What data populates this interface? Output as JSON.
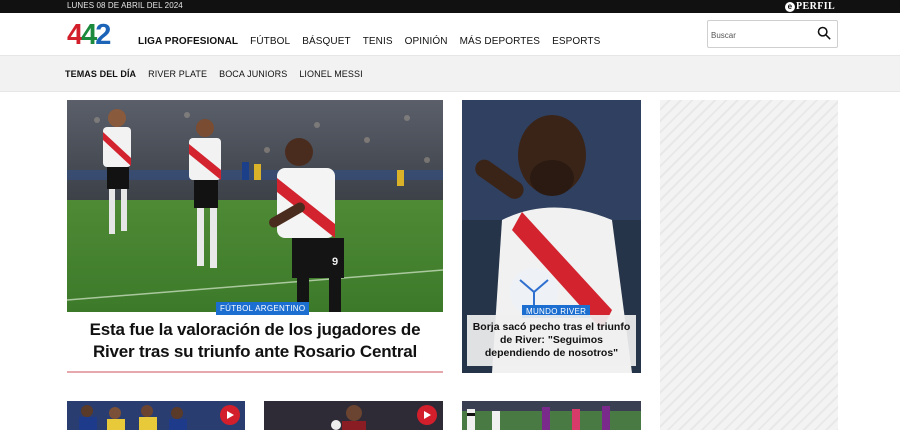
{
  "topbar": {
    "date": "LUNES 08 DE ABRIL DEL 2024",
    "brand": "PERFIL",
    "brand_mark": "e"
  },
  "header": {
    "logo": {
      "d1": "4",
      "d2": "4",
      "d3": "2"
    },
    "nav": [
      {
        "label": "LIGA PROFESIONAL",
        "bold": true
      },
      {
        "label": "FÚTBOL"
      },
      {
        "label": "BÁSQUET"
      },
      {
        "label": "TENIS"
      },
      {
        "label": "OPINIÓN"
      },
      {
        "label": "MÁS DEPORTES"
      },
      {
        "label": "ESPORTS"
      }
    ],
    "search": {
      "placeholder": "Buscar"
    }
  },
  "tags": {
    "lead": "TEMAS DEL DÍA",
    "items": [
      "RIVER PLATE",
      "BOCA JUNIORS",
      "LIONEL MESSI"
    ]
  },
  "main_article": {
    "category": "FÚTBOL ARGENTINO",
    "title": "Esta fue la valoración de los jugadores de River tras su triunfo ante Rosario Central"
  },
  "side_article": {
    "category": "MUNDO RIVER",
    "title": "Borja sacó pecho tras el triunfo de River: \"Seguimos dependiendo de nosotros\""
  },
  "colors": {
    "accent_blue": "#1c6fd1",
    "logo_red": "#d21f2b",
    "logo_green": "#1b8a3c",
    "logo_blue": "#1c64b8",
    "rule_pink": "#e6a7ad"
  },
  "icons": {
    "search": "search-icon",
    "play": "play-icon"
  }
}
